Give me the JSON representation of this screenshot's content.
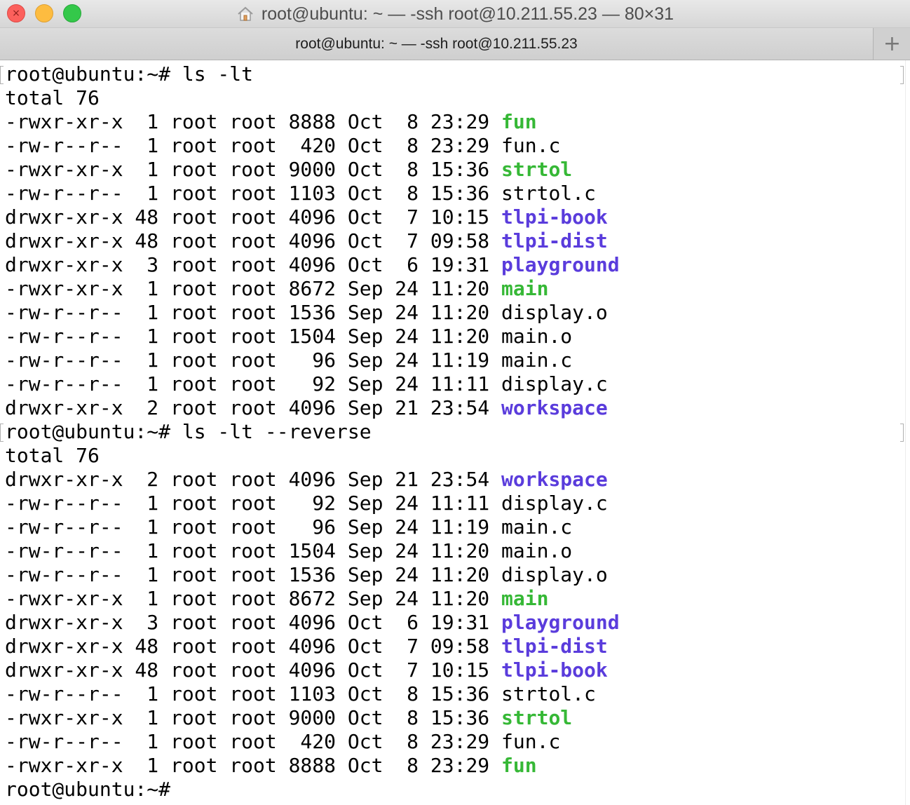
{
  "window": {
    "title": "root@ubuntu: ~ — -ssh root@10.211.55.23 — 80×31",
    "controls": {
      "close": "close",
      "minimize": "minimize",
      "zoom": "zoom"
    }
  },
  "tabbar": {
    "tab_title": "root@ubuntu: ~ — -ssh root@10.211.55.23",
    "new_tab_label": "+"
  },
  "icons": {
    "home": "home-icon",
    "close": "close-icon",
    "new_tab": "plus-icon"
  },
  "colors": {
    "executable": "#36b836",
    "directory": "#5a3cdc",
    "text": "#000000",
    "close": "#fc605c",
    "minimize": "#fdbc40",
    "zoom": "#34c84a"
  },
  "terminal": {
    "lines": [
      {
        "prefix": "root@ubuntu:~# ls -lt",
        "name": "",
        "type": "prompt"
      },
      {
        "prefix": "total 76",
        "name": "",
        "type": "text"
      },
      {
        "prefix": "-rwxr-xr-x  1 root root 8888 Oct  8 23:29 ",
        "name": "fun",
        "type": "exec"
      },
      {
        "prefix": "-rw-r--r--  1 root root  420 Oct  8 23:29 ",
        "name": "fun.c",
        "type": "file"
      },
      {
        "prefix": "-rwxr-xr-x  1 root root 9000 Oct  8 15:36 ",
        "name": "strtol",
        "type": "exec"
      },
      {
        "prefix": "-rw-r--r--  1 root root 1103 Oct  8 15:36 ",
        "name": "strtol.c",
        "type": "file"
      },
      {
        "prefix": "drwxr-xr-x 48 root root 4096 Oct  7 10:15 ",
        "name": "tlpi-book",
        "type": "dir"
      },
      {
        "prefix": "drwxr-xr-x 48 root root 4096 Oct  7 09:58 ",
        "name": "tlpi-dist",
        "type": "dir"
      },
      {
        "prefix": "drwxr-xr-x  3 root root 4096 Oct  6 19:31 ",
        "name": "playground",
        "type": "dir"
      },
      {
        "prefix": "-rwxr-xr-x  1 root root 8672 Sep 24 11:20 ",
        "name": "main",
        "type": "exec"
      },
      {
        "prefix": "-rw-r--r--  1 root root 1536 Sep 24 11:20 ",
        "name": "display.o",
        "type": "file"
      },
      {
        "prefix": "-rw-r--r--  1 root root 1504 Sep 24 11:20 ",
        "name": "main.o",
        "type": "file"
      },
      {
        "prefix": "-rw-r--r--  1 root root   96 Sep 24 11:19 ",
        "name": "main.c",
        "type": "file"
      },
      {
        "prefix": "-rw-r--r--  1 root root   92 Sep 24 11:11 ",
        "name": "display.c",
        "type": "file"
      },
      {
        "prefix": "drwxr-xr-x  2 root root 4096 Sep 21 23:54 ",
        "name": "workspace",
        "type": "dir"
      },
      {
        "prefix": "root@ubuntu:~# ls -lt --reverse",
        "name": "",
        "type": "prompt"
      },
      {
        "prefix": "total 76",
        "name": "",
        "type": "text"
      },
      {
        "prefix": "drwxr-xr-x  2 root root 4096 Sep 21 23:54 ",
        "name": "workspace",
        "type": "dir"
      },
      {
        "prefix": "-rw-r--r--  1 root root   92 Sep 24 11:11 ",
        "name": "display.c",
        "type": "file"
      },
      {
        "prefix": "-rw-r--r--  1 root root   96 Sep 24 11:19 ",
        "name": "main.c",
        "type": "file"
      },
      {
        "prefix": "-rw-r--r--  1 root root 1504 Sep 24 11:20 ",
        "name": "main.o",
        "type": "file"
      },
      {
        "prefix": "-rw-r--r--  1 root root 1536 Sep 24 11:20 ",
        "name": "display.o",
        "type": "file"
      },
      {
        "prefix": "-rwxr-xr-x  1 root root 8672 Sep 24 11:20 ",
        "name": "main",
        "type": "exec"
      },
      {
        "prefix": "drwxr-xr-x  3 root root 4096 Oct  6 19:31 ",
        "name": "playground",
        "type": "dir"
      },
      {
        "prefix": "drwxr-xr-x 48 root root 4096 Oct  7 09:58 ",
        "name": "tlpi-dist",
        "type": "dir"
      },
      {
        "prefix": "drwxr-xr-x 48 root root 4096 Oct  7 10:15 ",
        "name": "tlpi-book",
        "type": "dir"
      },
      {
        "prefix": "-rw-r--r--  1 root root 1103 Oct  8 15:36 ",
        "name": "strtol.c",
        "type": "file"
      },
      {
        "prefix": "-rwxr-xr-x  1 root root 9000 Oct  8 15:36 ",
        "name": "strtol",
        "type": "exec"
      },
      {
        "prefix": "-rw-r--r--  1 root root  420 Oct  8 23:29 ",
        "name": "fun.c",
        "type": "file"
      },
      {
        "prefix": "-rwxr-xr-x  1 root root 8888 Oct  8 23:29 ",
        "name": "fun",
        "type": "exec"
      },
      {
        "prefix": "root@ubuntu:~# ",
        "name": "",
        "type": "prompt"
      }
    ]
  }
}
